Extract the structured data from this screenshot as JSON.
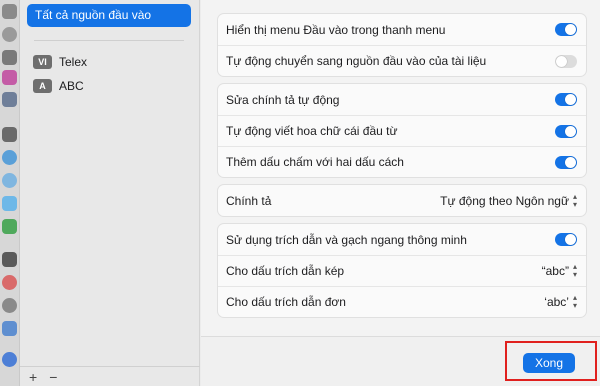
{
  "sidebar": {
    "selected_label": "Tất cả nguồn đầu vào",
    "items": [
      {
        "badge": "VI",
        "label": "Telex"
      },
      {
        "badge": "A",
        "label": "ABC"
      }
    ],
    "add_label": "+",
    "remove_label": "−"
  },
  "groups": {
    "menu": {
      "show_menu": {
        "label": "Hiển thị menu Đầu vào trong thanh menu",
        "on": true
      },
      "auto_switch": {
        "label": "Tự động chuyển sang nguồn đầu vào của tài liệu",
        "on": false
      }
    },
    "typing": {
      "autocorrect": {
        "label": "Sửa chính tả tự động",
        "on": true
      },
      "autocapitalize": {
        "label": "Tự động viết hoa chữ cái đầu từ",
        "on": true
      },
      "double_space_period": {
        "label": "Thêm dấu chấm với hai dấu cách",
        "on": true
      }
    },
    "spelling": {
      "label": "Chính tả",
      "value": "Tự động theo Ngôn ngữ"
    },
    "quotes": {
      "smart_quotes": {
        "label": "Sử dụng trích dẫn và gạch ngang thông minh",
        "on": true
      },
      "double_quotes": {
        "label": "Cho dấu trích dẫn kép",
        "value": "“abc”"
      },
      "single_quotes": {
        "label": "Cho dấu trích dẫn đơn",
        "value": "‘abc’"
      }
    }
  },
  "footer": {
    "done_label": "Xong"
  },
  "colors": {
    "accent": "#1473e6",
    "highlight": "#e0201e"
  }
}
